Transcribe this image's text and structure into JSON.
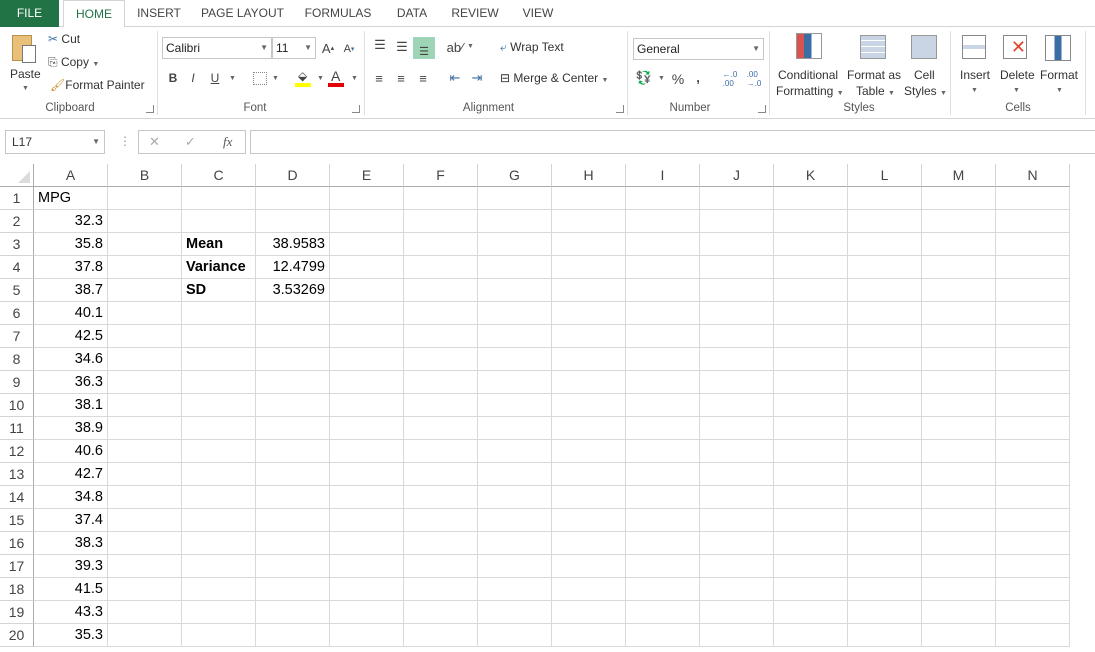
{
  "ribbon_tabs": [
    "FILE",
    "HOME",
    "INSERT",
    "PAGE LAYOUT",
    "FORMULAS",
    "DATA",
    "REVIEW",
    "VIEW"
  ],
  "active_tab": "HOME",
  "clipboard": {
    "paste": "Paste",
    "cut": "Cut",
    "copy": "Copy",
    "format_painter": "Format Painter",
    "label": "Clipboard"
  },
  "font": {
    "name": "Calibri",
    "size": "11",
    "label": "Font",
    "bold": "B",
    "italic": "I",
    "underline": "U",
    "grow": "A",
    "shrink": "A",
    "fill_color": "#ffff00",
    "font_color": "#ff0000"
  },
  "alignment": {
    "wrap_text": "Wrap Text",
    "merge_center": "Merge & Center",
    "label": "Alignment"
  },
  "number": {
    "format": "General",
    "percent": "%",
    "comma": ",",
    "inc_decimal": ".00",
    "dec_decimal": ".0",
    "label": "Number"
  },
  "styles": {
    "conditional_1": "Conditional",
    "conditional_2": "Formatting",
    "format_table_1": "Format as",
    "format_table_2": "Table",
    "cell_styles_1": "Cell",
    "cell_styles_2": "Styles",
    "label": "Styles"
  },
  "cells": {
    "insert": "Insert",
    "delete": "Delete",
    "format": "Format",
    "label": "Cells"
  },
  "formula_bar": {
    "name_box": "L17",
    "cancel": "✕",
    "enter": "✓",
    "fx": "fx",
    "formula": ""
  },
  "columns": [
    "A",
    "B",
    "C",
    "D",
    "E",
    "F",
    "G",
    "H",
    "I",
    "J",
    "K",
    "L",
    "M",
    "N"
  ],
  "rows": [
    "1",
    "2",
    "3",
    "4",
    "5",
    "6",
    "7",
    "8",
    "9",
    "10",
    "11",
    "12",
    "13",
    "14",
    "15",
    "16",
    "17",
    "18",
    "19",
    "20"
  ],
  "sheet": {
    "A": [
      "MPG",
      "32.3",
      "35.8",
      "37.8",
      "38.7",
      "40.1",
      "42.5",
      "34.6",
      "36.3",
      "38.1",
      "38.9",
      "40.6",
      "42.7",
      "34.8",
      "37.4",
      "38.3",
      "39.3",
      "41.5",
      "43.3",
      "35.3"
    ],
    "C": {
      "3": "Mean",
      "4": "Variance",
      "5": "SD"
    },
    "D": {
      "3": "38.9583",
      "4": "12.4799",
      "5": "3.53269"
    }
  },
  "colors": {
    "accent": "#217346",
    "selected_align": "#9fd5b7"
  }
}
